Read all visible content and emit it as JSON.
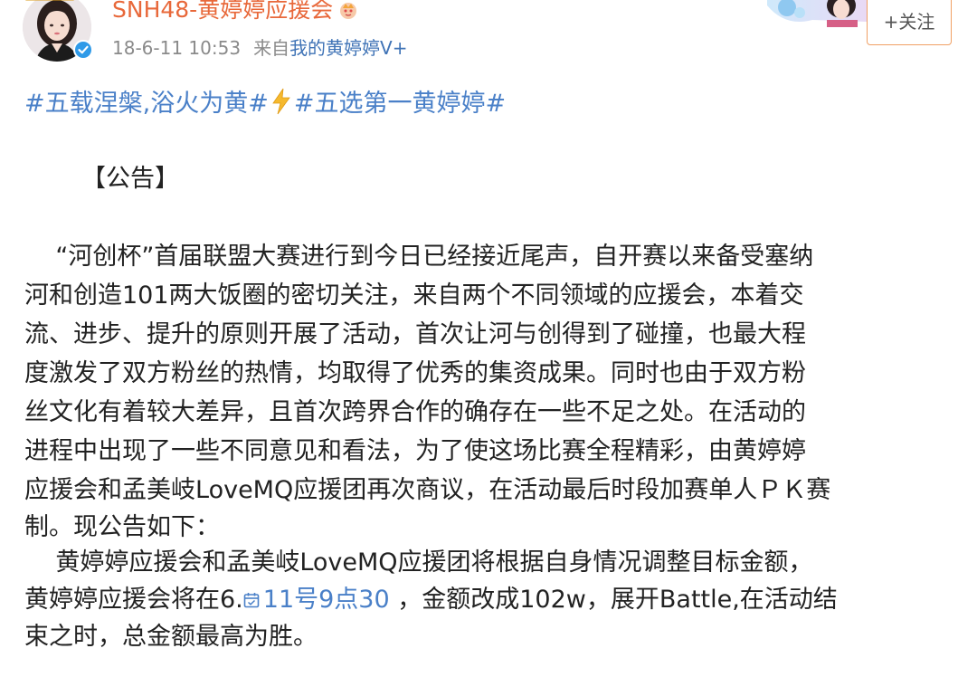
{
  "header": {
    "username": "SNH48-黄婷婷应援会",
    "timestamp": "18-6-11 10:53",
    "source_prefix": "来自",
    "source_link": "我的黄婷婷V+",
    "follow_label": "+关注"
  },
  "topics": {
    "topic1": "#五载涅槃,浴火为黄#",
    "topic2": "#五选第一黄婷婷#"
  },
  "post": {
    "title": "【公告】",
    "lines": [
      "    “河创杯”首届联盟大赛进行到今日已经接近尾声，自开赛以来备受塞纳",
      "河和创造101两大饭圈的密切关注，来自两个不同领域的应援会，本着交",
      "流、进步、提升的原则开展了活动，首次让河与创得到了碰撞，也最大程",
      "度激发了双方粉丝的热情，均取得了优秀的集资成果。同时也由于双方粉",
      "丝文化有着较大差异，且首次跨界合作的确存在一些不足之处。在活动的",
      "进程中出现了一些不同意见和看法，为了使这场比赛全程精彩，由黄婷婷",
      "应援会和孟美岐LoveMQ应援团再次商议，在活动最后时段加赛单人ＰＫ赛",
      "制。现公告如下：",
      "    黄婷婷应援会和孟美岐LoveMQ应援团将根据自身情况调整目标金额，"
    ],
    "line10_prefix": "黄婷婷应援会将在6.",
    "date_link": "11号9点30",
    "line10_suffix": " ，金额改成102w，展开Battle,在活动结",
    "line11": "束之时，总金额最高为胜。"
  },
  "colors": {
    "username": "#e8683a",
    "link": "#4a80c8",
    "meta": "#8a8a8a",
    "text": "#222222",
    "follow_border": "#f0a064"
  },
  "icons": [
    "verified-icon",
    "crown-icon",
    "user-badge-icon",
    "lightning-icon",
    "calendar-icon"
  ]
}
